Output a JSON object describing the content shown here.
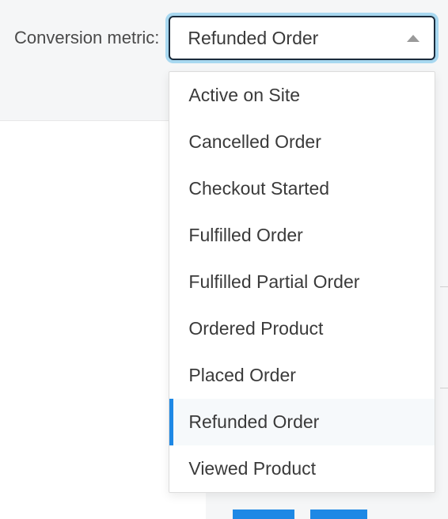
{
  "label": "Conversion metric:",
  "select": {
    "value": "Refunded Order",
    "options": [
      "Active on Site",
      "Cancelled Order",
      "Checkout Started",
      "Fulfilled Order",
      "Fulfilled Partial Order",
      "Ordered Product",
      "Placed Order",
      "Refunded Order",
      "Viewed Product"
    ],
    "selectedIndex": 7
  }
}
